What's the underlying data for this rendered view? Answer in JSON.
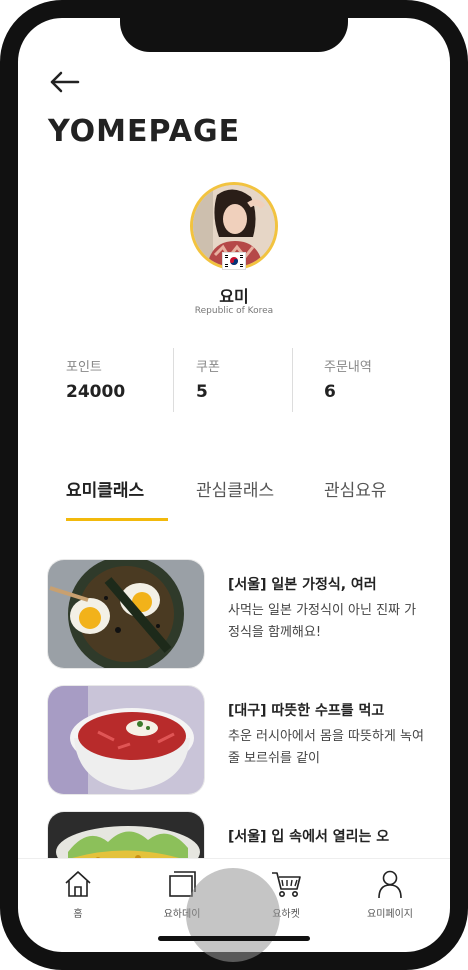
{
  "header": {
    "title": "YOMEPAGE"
  },
  "profile": {
    "name": "요미",
    "country": "Republic of Korea"
  },
  "stats": [
    {
      "label": "포인트",
      "value": "24000"
    },
    {
      "label": "쿠폰",
      "value": "5"
    },
    {
      "label": "주문내역",
      "value": "6"
    }
  ],
  "tabs": [
    {
      "label": "요미클래스",
      "active": true
    },
    {
      "label": "관심클래스",
      "active": false
    },
    {
      "label": "관심요유",
      "active": false
    }
  ],
  "classes": [
    {
      "title": "[서울] 일본 가정식, 여러",
      "desc": "사먹는 일본 가정식이 아닌 진짜 가정식을 함께해요!"
    },
    {
      "title": "[대구] 따뜻한 수프를 먹고",
      "desc": "추운 러시아에서 몸을 따뜻하게 녹여줄 보르쉬를 같이"
    },
    {
      "title": "[서울] 입 속에서 열리는 오",
      "desc": ""
    }
  ],
  "nav": [
    {
      "label": "홈",
      "icon": "home-icon"
    },
    {
      "label": "요하데이",
      "icon": "photo-frame-icon"
    },
    {
      "label": "요하켓",
      "icon": "cart-icon"
    },
    {
      "label": "요미페이지",
      "icon": "user-icon"
    }
  ],
  "colors": {
    "accent": "#f2b90c",
    "avatar_ring": "#f2c33f",
    "frame": "#111111"
  }
}
